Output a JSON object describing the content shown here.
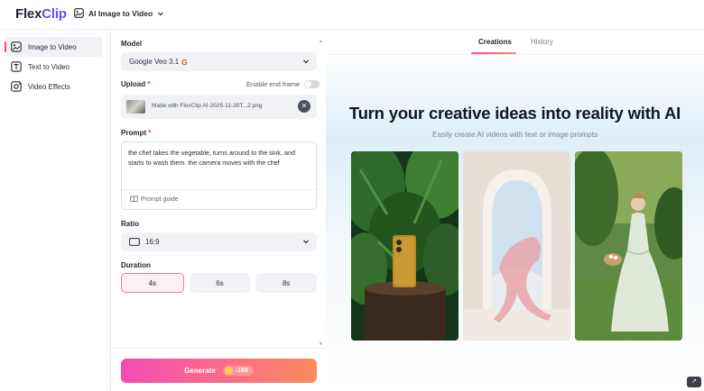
{
  "header": {
    "logo_text": "FlexClip",
    "tool_selector_label": "AI Image to Video"
  },
  "sidebar": {
    "items": [
      {
        "label": "Image to Video",
        "icon": "image-video-icon",
        "active": true
      },
      {
        "label": "Text to Video",
        "icon": "text-video-icon",
        "active": false
      },
      {
        "label": "Video Effects",
        "icon": "video-effects-icon",
        "active": false
      }
    ]
  },
  "panel": {
    "model": {
      "label": "Model",
      "value": "Google Veo 3.1",
      "badge": "G"
    },
    "upload": {
      "label": "Upload",
      "required_mark": "*",
      "end_frame_label": "Enable end frame",
      "end_frame_enabled": false,
      "file_name": "Made with FlexClip AI-2025-11-20T...2.png"
    },
    "prompt": {
      "label": "Prompt",
      "required_mark": "*",
      "text": "the chef takes the vegetable, turns around to the sink, and starts to wash them. the camera moves with the chef",
      "guide_label": "Prompt guide"
    },
    "ratio": {
      "label": "Ratio",
      "value": "16:9"
    },
    "duration": {
      "label": "Duration",
      "options": [
        "4s",
        "6s",
        "8s"
      ],
      "selected": "4s"
    },
    "generate": {
      "label": "Generate",
      "cost": "-150"
    }
  },
  "main": {
    "tabs": [
      {
        "label": "Creations",
        "active": true
      },
      {
        "label": "History",
        "active": false
      }
    ],
    "title": "Turn your creative ideas into reality with AI",
    "subtitle": "Easily create AI videos with text or image prompts"
  },
  "colors": {
    "accent_pink": "#f34cb6",
    "accent_orange": "#fd8b5c",
    "selected_border": "#f0789c",
    "active_indicator": "#f04b7a"
  }
}
